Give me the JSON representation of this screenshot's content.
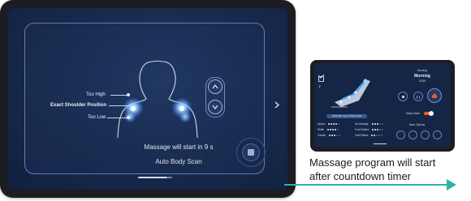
{
  "main_screen": {
    "labels": {
      "too_high": "Too High",
      "exact_shoulder": "Exact Shoulder Position",
      "too_low": "Too Low"
    },
    "status": "Massage will start in 9 s",
    "program": "Auto Body Scan",
    "icons": {
      "up": "chevron-up-icon",
      "down": "chevron-down-icon",
      "next": "chevron-right-icon",
      "stop": "stop-icon",
      "music": "music-note-icon"
    }
  },
  "side_screen": {
    "running_label": "Running",
    "program_name": "Morning",
    "timer": "29:58",
    "sleep_mode_label": "Sleep Mode",
    "more_options_label": "More Options",
    "shoulder_button": "Shoulder top & Body scan",
    "settings": {
      "left": [
        {
          "label": "Speed",
          "level": 4,
          "max": 5
        },
        {
          "label": "Width",
          "level": 4,
          "max": 5
        },
        {
          "label": "Vibrate",
          "level": 3,
          "max": 5
        }
      ],
      "right": [
        {
          "label": "Air Intensity",
          "level": 3,
          "max": 5
        },
        {
          "label": "Foot Rollers",
          "level": 3,
          "max": 5
        },
        {
          "label": "Calf Rollers",
          "level": 2,
          "max": 5
        }
      ]
    }
  },
  "caption": {
    "line1": "Massage program will start",
    "line2": "after countdown timer"
  },
  "colors": {
    "accent": "#2fb3a1",
    "screen_bg": "#17294b",
    "glow": "#3fa6ff",
    "home_active": "#e45d2b"
  }
}
